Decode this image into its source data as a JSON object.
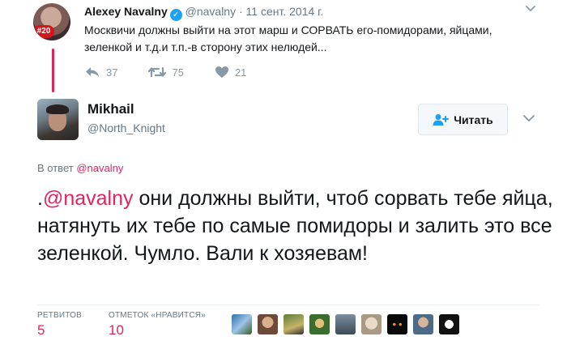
{
  "parent_tweet": {
    "avatar_badge": "#20",
    "name": "Alexey Navalny",
    "handle": "@navalny",
    "separator": "·",
    "date": "11 сент. 2014 г.",
    "text": "Москвичи должны выйти на этот марш и СОРВАТЬ его-помидорами, яйцами, зеленкой и т.д.и т.п.-в сторону этих нелюдей...",
    "actions": {
      "reply_count": "37",
      "retweet_count": "75",
      "like_count": "21"
    }
  },
  "main_tweet": {
    "name": "Mikhail",
    "handle": "@North_Knight",
    "follow_label": "Читать",
    "reply_prefix": "В ответ",
    "reply_handle": "@navalny",
    "text_prefix": ".",
    "text_mention": "@navalny",
    "text_body": " они должны выйти, чтоб сорвать тебе яйца, натянуть их тебе по самые помидоры и залить это все зеленкой. Чумло. Вали к хозяевам!",
    "stats": {
      "retweets_label": "РЕТВИТОВ",
      "retweets_value": "5",
      "likes_label": "ОТМЕТОК «НРАВИТСЯ»",
      "likes_value": "10"
    }
  },
  "colors": {
    "accent": "#e0245e",
    "verified": "#1da1f2",
    "muted": "#657786",
    "icon_grey": "#8899a6"
  },
  "icons": [
    "verified-icon",
    "chevron-down-icon",
    "reply-icon",
    "retweet-icon",
    "heart-icon",
    "follow-person-icon"
  ]
}
